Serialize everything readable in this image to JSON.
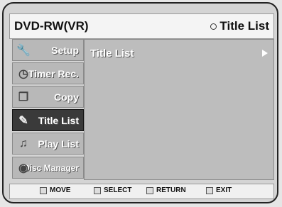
{
  "header": {
    "mode": "DVD-RW(VR)",
    "title": "Title List"
  },
  "sidebar": {
    "items": [
      {
        "label": "Setup",
        "icon": "wrench-icon"
      },
      {
        "label": "Timer Rec.",
        "icon": "clock-icon"
      },
      {
        "label": "Copy",
        "icon": "copy-icon"
      },
      {
        "label": "Title List",
        "icon": "pencil-icon",
        "active": true
      },
      {
        "label": "Play List",
        "icon": "music-note-icon"
      },
      {
        "label": "Disc Manager",
        "icon": "disc-icon"
      }
    ]
  },
  "main": {
    "item_label": "Title List"
  },
  "footer": {
    "move": "MOVE",
    "select": "SELECT",
    "return": "RETURN",
    "exit": "EXIT"
  }
}
